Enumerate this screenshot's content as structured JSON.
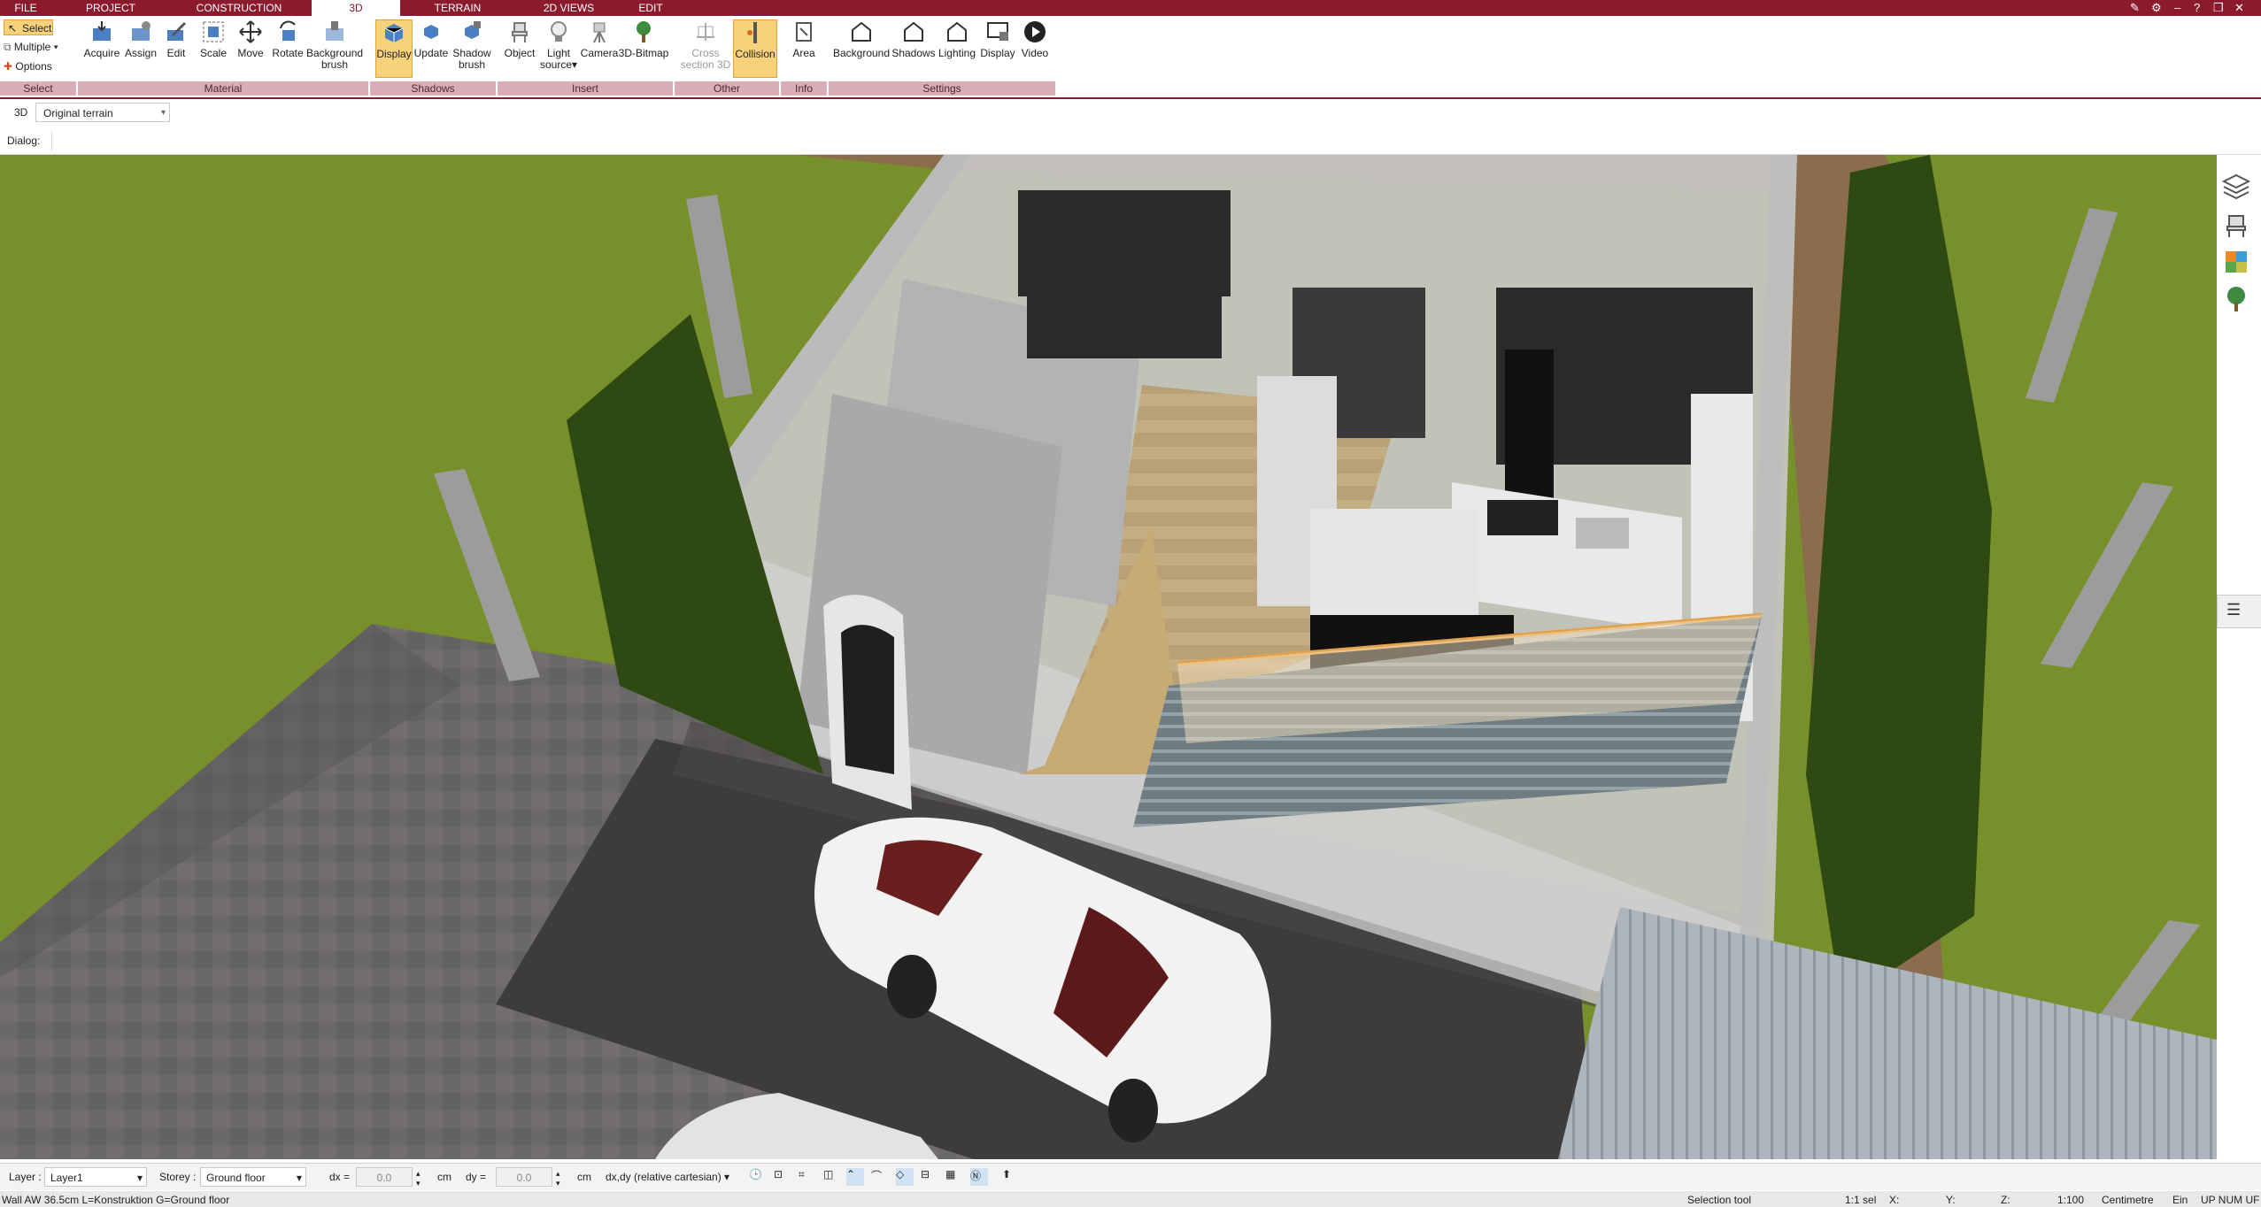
{
  "menu": {
    "tabs": [
      {
        "label": "FILE"
      },
      {
        "label": "PROJECT"
      },
      {
        "label": "CONSTRUCTION"
      },
      {
        "label": "3D"
      },
      {
        "label": "TERRAIN"
      },
      {
        "label": "2D VIEWS"
      },
      {
        "label": "EDIT"
      }
    ],
    "active_tab": "3D"
  },
  "ribbon": {
    "select": {
      "select_label": "Select",
      "multiple_label": "Multiple",
      "options_label": "Options"
    },
    "material": [
      "Acquire",
      "Assign",
      "Edit",
      "Scale",
      "Move",
      "Rotate"
    ],
    "material_bg": {
      "line1": "Background",
      "line2": "brush"
    },
    "shadows": {
      "display": "Display",
      "update": "Update",
      "shadow_l1": "Shadow",
      "shadow_l2": "brush"
    },
    "insert": {
      "object": "Object",
      "light_l1": "Light",
      "light_l2": "source",
      "camera": "Camera",
      "bitmap": "3D-Bitmap"
    },
    "other": {
      "cross_l1": "Cross",
      "cross_l2": "section 3D",
      "collision": "Collision"
    },
    "info": {
      "area": "Area"
    },
    "settings": [
      "Background",
      "Shadows",
      "Lighting",
      "Display",
      "Video"
    ],
    "groups": [
      "Select",
      "Material",
      "Shadows",
      "Insert",
      "Other",
      "Info",
      "Settings"
    ]
  },
  "view_toolbar": {
    "mode_label": "3D",
    "terrain_value": "Original terrain",
    "dialog_label": "Dialog:"
  },
  "status": {
    "layer_label": "Layer :",
    "layer_value": "Layer1",
    "storey_label": "Storey :",
    "storey_value": "Ground floor",
    "dx_label": "dx =",
    "dx_value": "0.0",
    "dx_unit": "cm",
    "dy_label": "dy =",
    "dy_value": "0.0",
    "dy_unit": "cm",
    "coord_mode": "dx,dy (relative cartesian)"
  },
  "info": {
    "message": "Wall AW 36.5cm L=Konstruktion G=Ground floor",
    "tool": "Selection tool",
    "selected": "1:1 sel",
    "x_label": "X:",
    "y_label": "Y:",
    "z_label": "Z:",
    "scale": "1:100",
    "unit": "Centimetre",
    "ein": "Ein",
    "num": "UP  NUM  UF"
  },
  "colors": {
    "brand": "#8b1a2c",
    "active": "#f8d27a",
    "group": "#d9aeb6"
  }
}
